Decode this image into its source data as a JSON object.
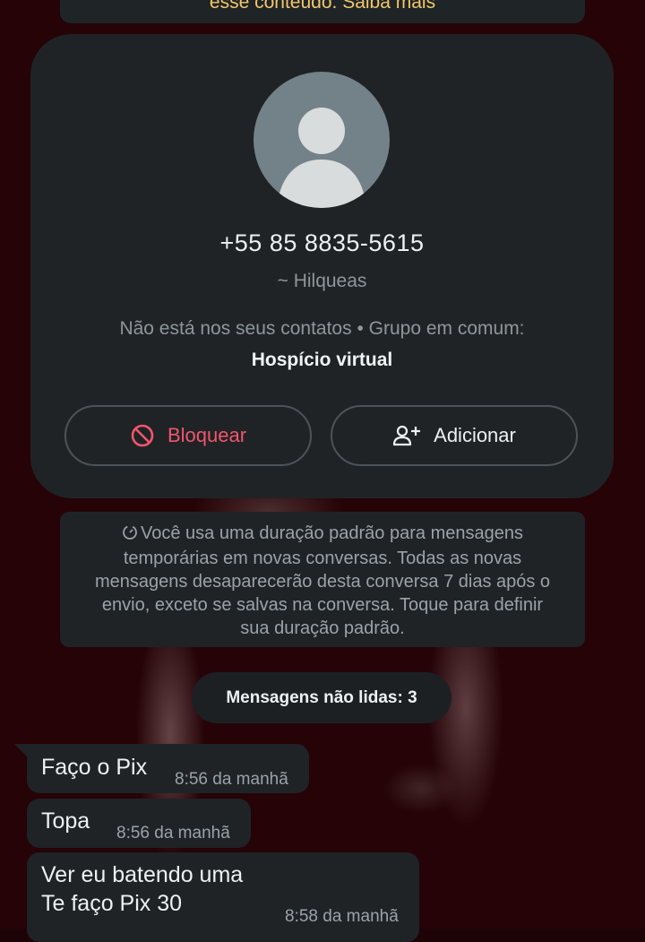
{
  "banner": {
    "text": "esse conteúdo. Saiba mais",
    "text_color": "#f3c76a"
  },
  "contact": {
    "avatar_icon": "default-person-avatar",
    "phone": "+55 85 8835-5615",
    "nickname": "~ Hilqueas",
    "info_line": "Não está nos seus contatos • Grupo em comum:",
    "group_name": "Hospício virtual",
    "block_button": {
      "icon": "block-icon",
      "label": "Bloquear",
      "color": "#f1566b"
    },
    "add_button": {
      "icon": "add-person-icon",
      "label": "Adicionar"
    }
  },
  "disappearing_notice": {
    "icon": "timer-icon",
    "lines": [
      "Você usa uma duração padrão para mensagens",
      "temporárias em novas conversas. Todas as novas",
      "mensagens desaparecerão desta conversa 7 dias após o",
      "envio, exceto se salvas na conversa. Toque para definir",
      "sua duração padrão."
    ]
  },
  "unread_divider": {
    "label": "Mensagens não lidas: 3"
  },
  "messages": [
    {
      "lines": [
        "Faço o Pix"
      ],
      "time": "8:56 da manhã"
    },
    {
      "lines": [
        "Topa"
      ],
      "time": "8:56 da manhã"
    },
    {
      "lines": [
        "Ver eu batendo uma",
        "Te faço Pix 30"
      ],
      "time": "8:58 da manhã"
    }
  ],
  "colors": {
    "card_background": "#1f2326",
    "wallpaper": "#250307"
  }
}
